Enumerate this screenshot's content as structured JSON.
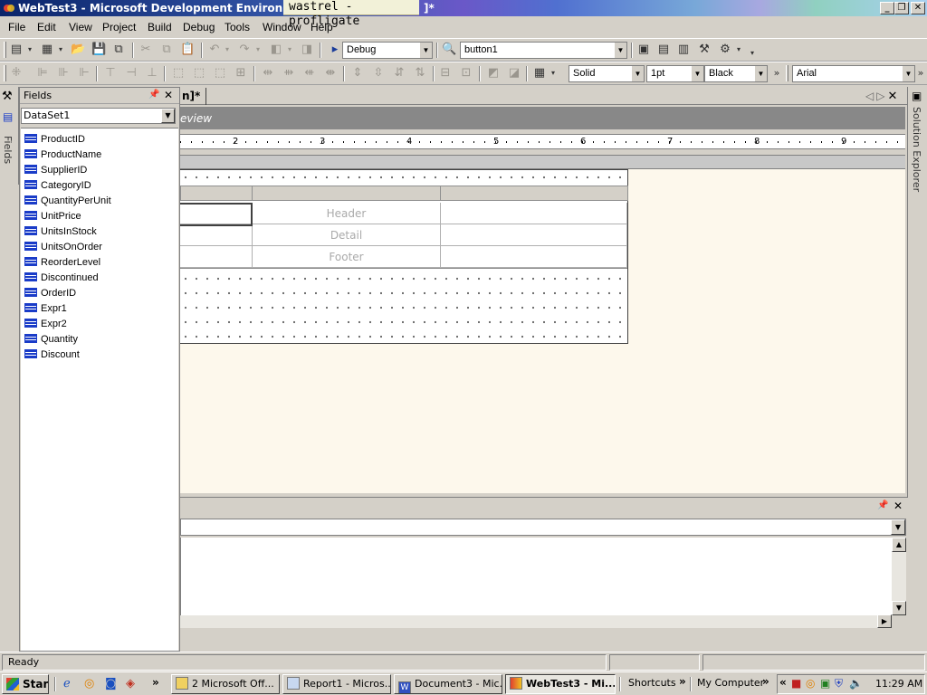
{
  "window": {
    "title": "WebTest3 - Microsoft Development Environment [d",
    "title_suffix": "]*",
    "overlay_text": "wastrel - profligate"
  },
  "menu": [
    "File",
    "Edit",
    "View",
    "Project",
    "Build",
    "Debug",
    "Tools",
    "Window",
    "Help"
  ],
  "toolbar1": {
    "config_combo": "Debug",
    "object_combo": "button1"
  },
  "toolbar2": {
    "border_style": "Solid",
    "border_width": "1pt",
    "border_color": "Black",
    "font_name": "Arial"
  },
  "fields_panel": {
    "title": "Fields",
    "dataset": "DataSet1",
    "tab_label": "Fields",
    "items": [
      "ProductID",
      "ProductName",
      "SupplierID",
      "CategoryID",
      "QuantityPerUnit",
      "UnitPrice",
      "UnitsInStock",
      "UnitsOnOrder",
      "ReorderLevel",
      "Discontinued",
      "OrderID",
      "Expr1",
      "Expr2",
      "Quantity",
      "Discount"
    ]
  },
  "solution_explorer_label": "Solution Explorer",
  "document": {
    "tab_label": "n]*",
    "band_text": "eview",
    "ruler_numbers": [
      "2",
      "3",
      "4",
      "5",
      "6",
      "7",
      "8",
      "9"
    ],
    "table_rows": [
      "Header",
      "Detail",
      "Footer"
    ]
  },
  "status": {
    "text": "Ready"
  },
  "taskbar": {
    "start": "Start",
    "buttons": [
      "2 Microsoft Off...",
      "Report1 - Micros...",
      "Document3 - Mic...",
      "WebTest3 - Mi..."
    ],
    "shortcuts": "Shortcuts",
    "my_computer": "My Computer",
    "clock": "11:29 AM"
  },
  "colors": {
    "title_start": "#0a246a",
    "field_icon": "#1a3cc8",
    "canvas": "#fdf8ec"
  }
}
